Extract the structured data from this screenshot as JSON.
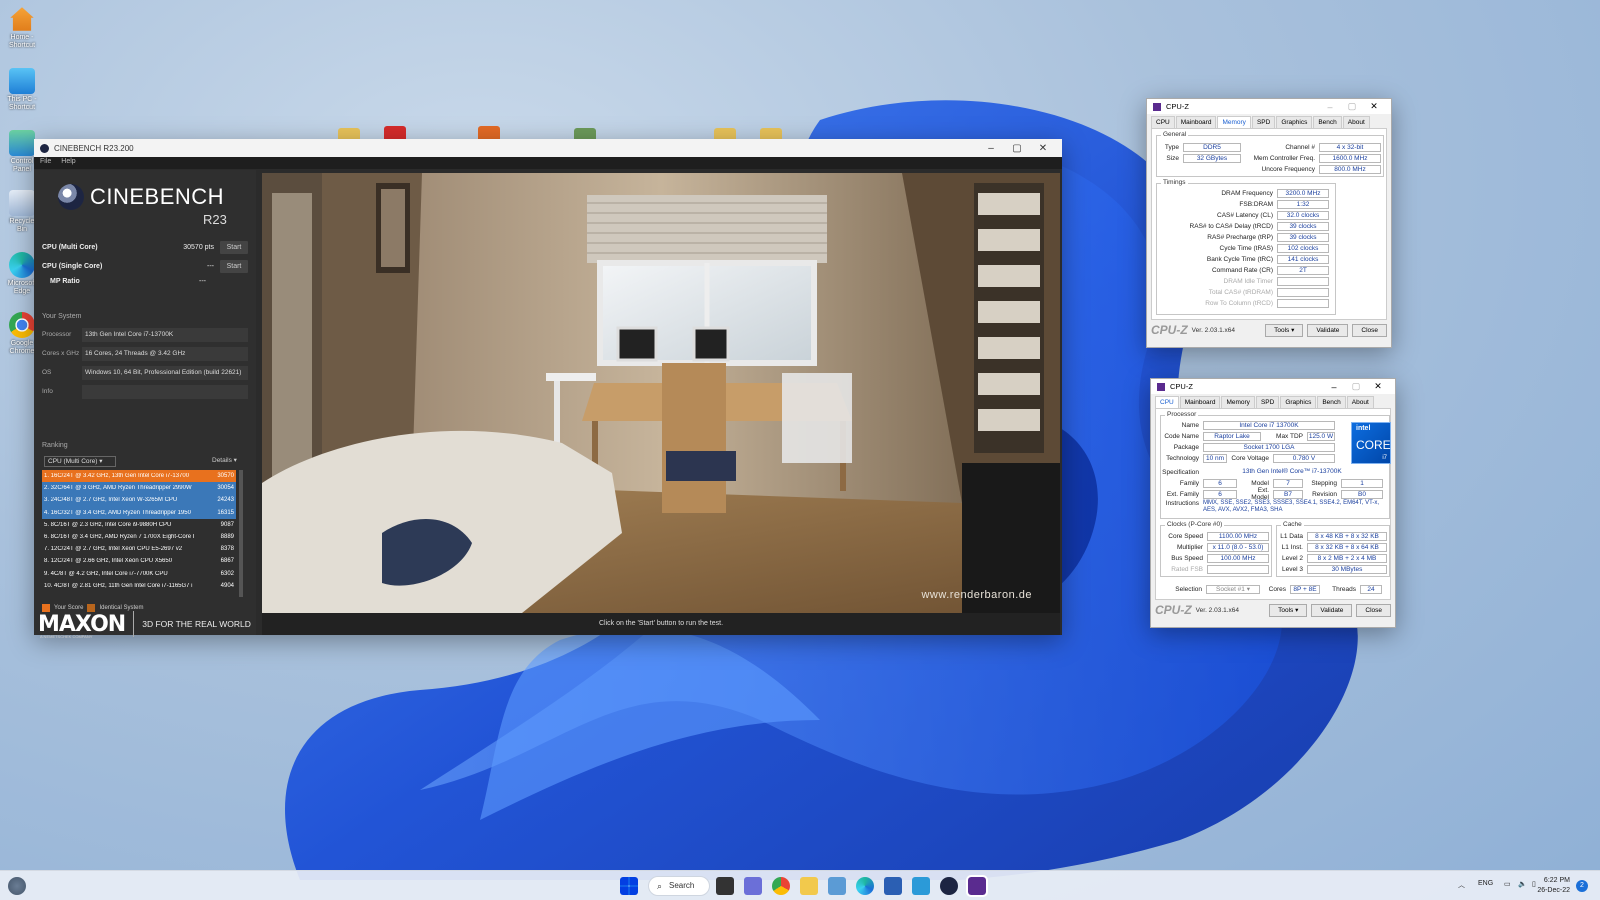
{
  "desktop": {
    "icons": [
      {
        "label": "Home - Shortcut"
      },
      {
        "label": "This PC - Shortcut"
      },
      {
        "label": "Control Panel"
      },
      {
        "label": "Recycle Bin"
      },
      {
        "label": "Microsoft Edge"
      },
      {
        "label": "Google Chrome"
      }
    ]
  },
  "cinebench": {
    "title": "CINEBENCH R23.200",
    "menu": [
      "File",
      "Help"
    ],
    "logo_name": "CINEBENCH",
    "logo_version": "R23",
    "multi_label": "CPU (Multi Core)",
    "multi_value": "30570 pts",
    "single_label": "CPU (Single Core)",
    "single_value": "---",
    "mp_label": "MP Ratio",
    "mp_value": "---",
    "start_label": "Start",
    "your_system": "Your System",
    "sys": [
      {
        "k": "Processor",
        "v": "13th Gen Intel Core i7-13700K"
      },
      {
        "k": "Cores x GHz",
        "v": "16 Cores, 24 Threads @ 3.42 GHz"
      },
      {
        "k": "OS",
        "v": "Windows 10, 64 Bit, Professional Edition (build 22621)"
      },
      {
        "k": "Info",
        "v": ""
      }
    ],
    "ranking_label": "Ranking",
    "ranking_select": "CPU (Multi Core)",
    "details_label": "Details",
    "ranking": [
      {
        "t": "1. 16C/24T @ 3.42 GHz, 13th Gen Intel Core i7-13700",
        "s": "30570",
        "c": "#e8711e"
      },
      {
        "t": "2. 32C/64T @ 3 GHz, AMD Ryzen Threadripper 2990W",
        "s": "30054",
        "c": "#3b78b8"
      },
      {
        "t": "3. 24C/48T @ 2.7 GHz, Intel Xeon W-3265M CPU",
        "s": "24243",
        "c": "#3b78b8"
      },
      {
        "t": "4. 16C/32T @ 3.4 GHz, AMD Ryzen Threadripper 1950",
        "s": "16315",
        "c": "#3b78b8"
      },
      {
        "t": "5. 8C/16T @ 2.3 GHz, Intel Core i9-9880H CPU",
        "s": "9087",
        "c": "#2f2f2f"
      },
      {
        "t": "6. 8C/16T @ 3.4 GHz, AMD Ryzen 7 1700X Eight-Core I",
        "s": "8889",
        "c": "#2f2f2f"
      },
      {
        "t": "7. 12C/24T @ 2.7 GHz, Intel Xeon CPU E5-2697 v2",
        "s": "8378",
        "c": "#2f2f2f"
      },
      {
        "t": "8. 12C/24T @ 2.66 GHz, Intel Xeon CPU X5650",
        "s": "6867",
        "c": "#2f2f2f"
      },
      {
        "t": "9. 4C/8T @ 4.2 GHz, Intel Core i7-7700K CPU",
        "s": "6302",
        "c": "#2f2f2f"
      },
      {
        "t": "10. 4C/8T @ 2.81 GHz, 11th Gen Intel Core i7-1165G7 i",
        "s": "4904",
        "c": "#2f2f2f"
      }
    ],
    "legend_your": "Your Score",
    "legend_identical": "Identical System",
    "maxon": "MAXON",
    "maxon_sub": "A NEMETSCHEK COMPANY",
    "tagline": "3D FOR THE REAL WORLD",
    "watermark": "www.renderbaron.de",
    "status": "Click on the 'Start' button to run the test."
  },
  "cpuz_mem": {
    "title": "CPU-Z",
    "tabs": [
      "CPU",
      "Mainboard",
      "Memory",
      "SPD",
      "Graphics",
      "Bench",
      "About"
    ],
    "active": "Memory",
    "general_label": "General",
    "type_k": "Type",
    "type_v": "DDR5",
    "size_k": "Size",
    "size_v": "32 GBytes",
    "channel_k": "Channel #",
    "channel_v": "4 x 32-bit",
    "mcf_k": "Mem Controller Freq.",
    "mcf_v": "1600.0 MHz",
    "uncore_k": "Uncore Frequency",
    "uncore_v": "800.0 MHz",
    "timings_label": "Timings",
    "timings": [
      {
        "k": "DRAM Frequency",
        "v": "3200.0 MHz"
      },
      {
        "k": "FSB:DRAM",
        "v": "1:32"
      },
      {
        "k": "CAS# Latency (CL)",
        "v": "32.0 clocks"
      },
      {
        "k": "RAS# to CAS# Delay (tRCD)",
        "v": "39 clocks"
      },
      {
        "k": "RAS# Precharge (tRP)",
        "v": "39 clocks"
      },
      {
        "k": "Cycle Time (tRAS)",
        "v": "102 clocks"
      },
      {
        "k": "Bank Cycle Time (tRC)",
        "v": "141 clocks"
      },
      {
        "k": "Command Rate (CR)",
        "v": "2T"
      },
      {
        "k": "DRAM Idle Timer",
        "v": ""
      },
      {
        "k": "Total CAS# (tRDRAM)",
        "v": ""
      },
      {
        "k": "Row To Column (tRCD)",
        "v": ""
      }
    ],
    "brand": "CPU-Z",
    "version": "Ver. 2.03.1.x64",
    "tools": "Tools",
    "validate": "Validate",
    "close": "Close"
  },
  "cpuz_cpu": {
    "title": "CPU-Z",
    "tabs": [
      "CPU",
      "Mainboard",
      "Memory",
      "SPD",
      "Graphics",
      "Bench",
      "About"
    ],
    "active": "CPU",
    "processor_label": "Processor",
    "name_k": "Name",
    "name_v": "Intel Core i7 13700K",
    "code_k": "Code Name",
    "code_v": "Raptor Lake",
    "tdp_k": "Max TDP",
    "tdp_v": "125.0 W",
    "pkg_k": "Package",
    "pkg_v": "Socket 1700 LGA",
    "tech_k": "Technology",
    "tech_v": "10 nm",
    "cv_k": "Core Voltage",
    "cv_v": "0.780 V",
    "spec_k": "Specification",
    "spec_v": "13th Gen Intel® Core™ i7-13700K",
    "fam_k": "Family",
    "fam_v": "6",
    "model_k": "Model",
    "model_v": "7",
    "step_k": "Stepping",
    "step_v": "1",
    "efam_k": "Ext. Family",
    "efam_v": "6",
    "emodel_k": "Ext. Model",
    "emodel_v": "B7",
    "rev_k": "Revision",
    "rev_v": "B0",
    "instr_k": "Instructions",
    "instr_v": "MMX, SSE, SSE2, SSE3, SSSE3, SSE4.1, SSE4.2, EM64T, VT-x, AES, AVX, AVX2, FMA3, SHA",
    "clocks_label": "Clocks (P-Core #0)",
    "cs_k": "Core Speed",
    "cs_v": "1100.00 MHz",
    "mul_k": "Multiplier",
    "mul_v": "x 11.0 (8.0 - 53.0)",
    "bus_k": "Bus Speed",
    "bus_v": "100.00 MHz",
    "fsb_k": "Rated FSB",
    "fsb_v": "",
    "cache_label": "Cache",
    "l1d_k": "L1 Data",
    "l1d_v": "8 x 48 KB + 8 x 32 KB",
    "l1i_k": "L1 Inst.",
    "l1i_v": "8 x 32 KB + 8 x 64 KB",
    "l2_k": "Level 2",
    "l2_v": "8 x 2 MB + 2 x 4 MB",
    "l3_k": "Level 3",
    "l3_v": "30 MBytes",
    "sel_k": "Selection",
    "sel_v": "Socket #1",
    "cores_k": "Cores",
    "cores_v": "8P + 8E",
    "threads_k": "Threads",
    "threads_v": "24",
    "intel_l1": "intel",
    "intel_l2": "CORE",
    "intel_l3": "i7",
    "brand": "CPU-Z",
    "version": "Ver. 2.03.1.x64",
    "tools": "Tools",
    "validate": "Validate",
    "close": "Close"
  },
  "taskbar": {
    "search": "Search",
    "lang": "ENG",
    "time": "6:22 PM",
    "date": "26-Dec-22",
    "badge": "2"
  }
}
